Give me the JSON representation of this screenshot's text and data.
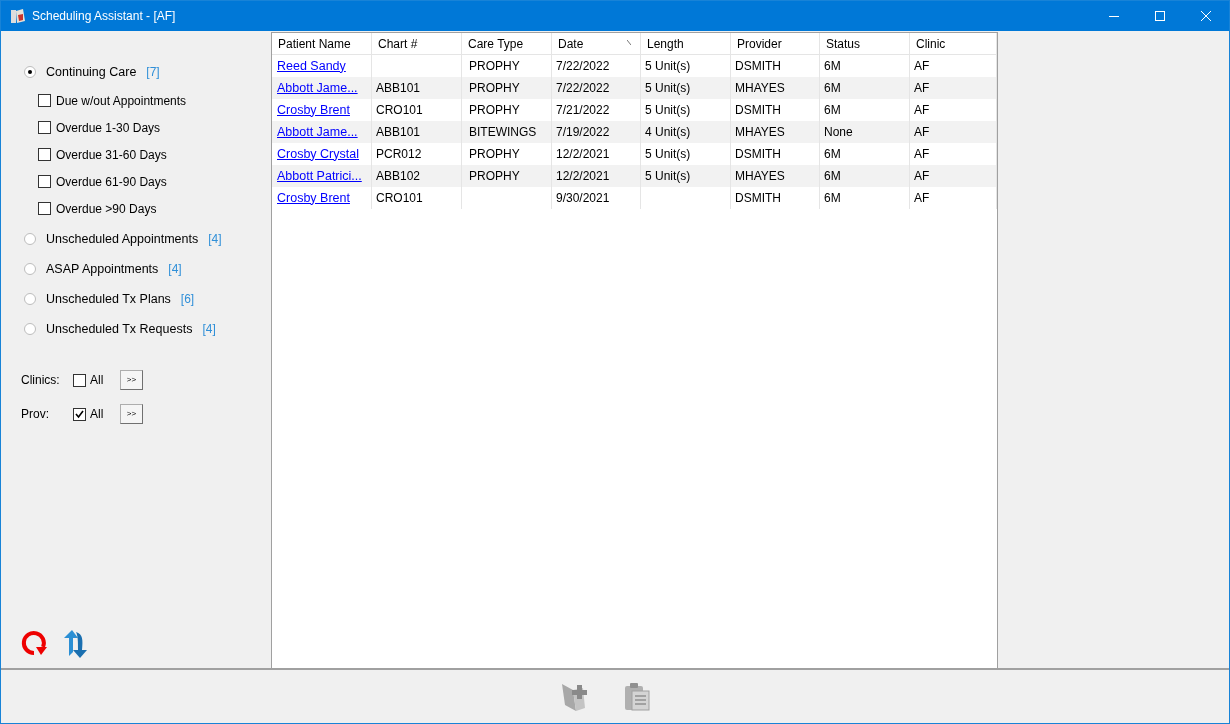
{
  "window": {
    "title": "Scheduling Assistant - [AF]"
  },
  "filters": [
    {
      "label": "Continuing Care",
      "count": "[7]",
      "selected": true,
      "children": [
        {
          "label": "Due w/out Appointments",
          "checked": false
        },
        {
          "label": "Overdue 1-30 Days",
          "checked": false
        },
        {
          "label": "Overdue 31-60 Days",
          "checked": false
        },
        {
          "label": "Overdue 61-90 Days",
          "checked": false
        },
        {
          "label": "Overdue >90 Days",
          "checked": false
        }
      ]
    },
    {
      "label": "Unscheduled Appointments",
      "count": "[4]",
      "selected": false
    },
    {
      "label": "ASAP Appointments",
      "count": "[4]",
      "selected": false
    },
    {
      "label": "Unscheduled Tx Plans",
      "count": "[6]",
      "selected": false
    },
    {
      "label": "Unscheduled Tx Requests",
      "count": "[4]",
      "selected": false
    }
  ],
  "selectors": [
    {
      "label": "Clinics:",
      "option": "All",
      "checked": false,
      "button": ">>"
    },
    {
      "label": "Prov:",
      "option": "All",
      "checked": true,
      "button": ">>"
    }
  ],
  "table": {
    "columns": [
      {
        "label": "Patient Name",
        "sorted": false
      },
      {
        "label": "Chart #",
        "sorted": false
      },
      {
        "label": "Care Type",
        "sorted": false
      },
      {
        "label": "Date",
        "sorted": true
      },
      {
        "label": "Length",
        "sorted": false
      },
      {
        "label": "Provider",
        "sorted": false
      },
      {
        "label": "Status",
        "sorted": false
      },
      {
        "label": "Clinic",
        "sorted": false
      }
    ],
    "rows": [
      [
        "Reed Sandy",
        "",
        "PROPHY",
        "7/22/2022",
        "5 Unit(s)",
        "DSMITH",
        "6M",
        "AF"
      ],
      [
        "Abbott Jame...",
        "ABB101",
        "PROPHY",
        "7/22/2022",
        "5 Unit(s)",
        "MHAYES",
        "6M",
        "AF"
      ],
      [
        "Crosby Brent",
        "CRO101",
        "PROPHY",
        "7/21/2022",
        "5 Unit(s)",
        "DSMITH",
        "6M",
        "AF"
      ],
      [
        "Abbott Jame...",
        "ABB101",
        "BITEWINGS",
        "7/19/2022",
        "4 Unit(s)",
        "MHAYES",
        "None",
        "AF"
      ],
      [
        "Crosby Crystal",
        "PCR012",
        "PROPHY",
        "12/2/2021",
        "5 Unit(s)",
        "DSMITH",
        "6M",
        "AF"
      ],
      [
        "Abbott Patrici...",
        "ABB102",
        "PROPHY",
        "12/2/2021",
        "5 Unit(s)",
        "MHAYES",
        "6M",
        "AF"
      ],
      [
        "Crosby Brent",
        "CRO101",
        "",
        "9/30/2021",
        "",
        "DSMITH",
        "6M",
        "AF"
      ]
    ]
  }
}
